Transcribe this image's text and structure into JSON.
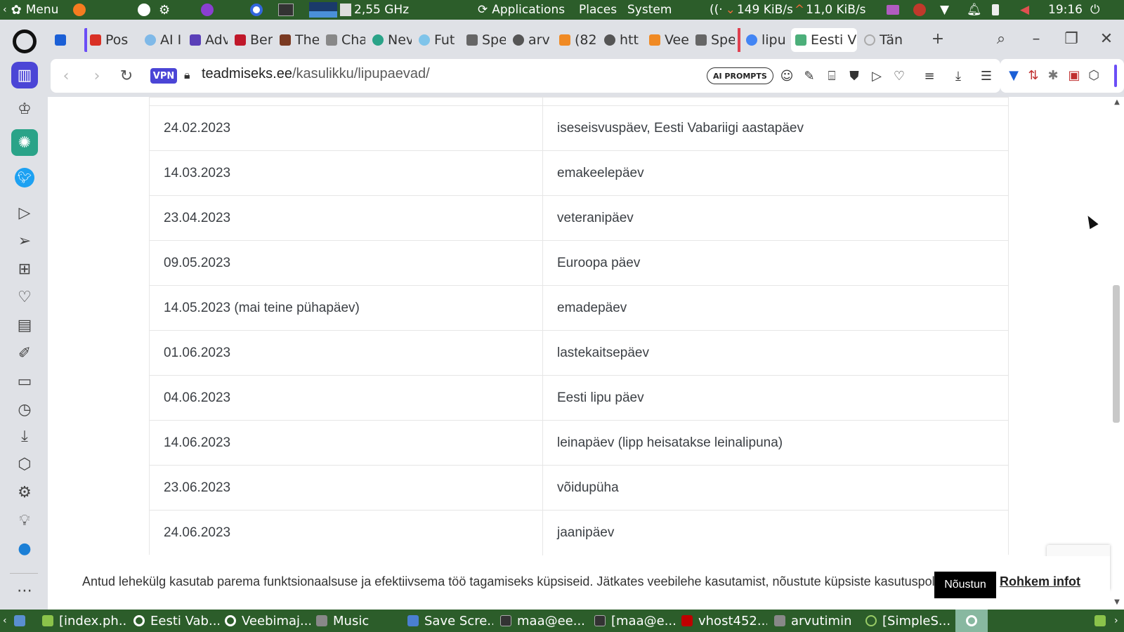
{
  "system_panel": {
    "menu_label": "Menu",
    "cpu_freq": "2,55 GHz",
    "applications": "Applications",
    "places": "Places",
    "system": "System",
    "net_down": "149 KiB/s",
    "net_up": "11,0 KiB/s",
    "clock": "19:16"
  },
  "tabs": [
    {
      "label": "Pos",
      "icon": "gmail-icon"
    },
    {
      "label": "AI I",
      "icon": "ai-icon"
    },
    {
      "label": "Adv",
      "icon": "adv-icon"
    },
    {
      "label": "Ber",
      "icon": "ber-icon"
    },
    {
      "label": "The",
      "icon": "the-icon"
    },
    {
      "label": "Cha",
      "icon": "chat-icon"
    },
    {
      "label": "Nev",
      "icon": "chatgpt-icon"
    },
    {
      "label": "Fut",
      "icon": "fut-icon"
    },
    {
      "label": "Spe",
      "icon": "grid-icon"
    },
    {
      "label": "arv",
      "icon": "globe-icon"
    },
    {
      "label": "(82",
      "icon": "fox-icon"
    },
    {
      "label": "htt",
      "icon": "globe-icon"
    },
    {
      "label": "Vee",
      "icon": "fox-icon"
    },
    {
      "label": "Spe",
      "icon": "grid-icon"
    },
    {
      "label": "lipu",
      "icon": "google-icon"
    },
    {
      "label": "Eesti V",
      "icon": "site-icon"
    },
    {
      "label": "Tän",
      "icon": "loading-icon"
    }
  ],
  "address_bar": {
    "vpn_label": "VPN",
    "url_host": "teadmiseks.ee",
    "url_path": "/kasulikku/lipupaevad/",
    "ai_prompts_label": "AI PROMPTS"
  },
  "table": {
    "rows": [
      {
        "date": "24.02.2023",
        "name": "iseseisvuspäev, Eesti Vabariigi aastapäev"
      },
      {
        "date": "14.03.2023",
        "name": "emakeelepäev"
      },
      {
        "date": "23.04.2023",
        "name": "veteranipäev"
      },
      {
        "date": "09.05.2023",
        "name": "Euroopa päev"
      },
      {
        "date": "14.05.2023 (mai teine pühapäev)",
        "name": "emadepäev"
      },
      {
        "date": "01.06.2023",
        "name": "lastekaitsepäev"
      },
      {
        "date": "04.06.2023",
        "name": "Eesti lipu päev"
      },
      {
        "date": "14.06.2023",
        "name": "leinapäev (lipp heisatakse leinalipuna)"
      },
      {
        "date": "23.06.2023",
        "name": "võidupüha"
      },
      {
        "date": "24.06.2023",
        "name": "jaanipäev"
      }
    ]
  },
  "cookie_banner": {
    "text": "Antud lehekülg kasutab parema funktsionaalsuse ja efektiivsema töö tagamiseks küpsiseid. Jätkates veebilehe kasutamist, nõustute küpsiste kasutuspoliitikaga.",
    "accept_label": "Nõustun",
    "more_label": "Rohkem infot"
  },
  "taskbar": [
    {
      "label": "[index.ph...",
      "icon": "editor-icon"
    },
    {
      "label": "Eesti Vab...",
      "icon": "opera-icon"
    },
    {
      "label": "Veebimaj...",
      "icon": "opera-icon"
    },
    {
      "label": "Music",
      "icon": "folder-icon"
    },
    {
      "label": "Save Scre...",
      "icon": "screenshot-icon"
    },
    {
      "label": "maa@ee...",
      "icon": "terminal-icon"
    },
    {
      "label": "[maa@e...",
      "icon": "terminal-icon"
    },
    {
      "label": "vhost452...",
      "icon": "filezilla-icon"
    },
    {
      "label": "arvutimin",
      "icon": "folder-icon"
    },
    {
      "label": "[SimpleS...",
      "icon": "app-icon"
    }
  ],
  "colors": {
    "panel_green": "#2c5d2a",
    "chrome_bg": "#dfe1e6",
    "vpn_purple": "#4b45d6"
  }
}
